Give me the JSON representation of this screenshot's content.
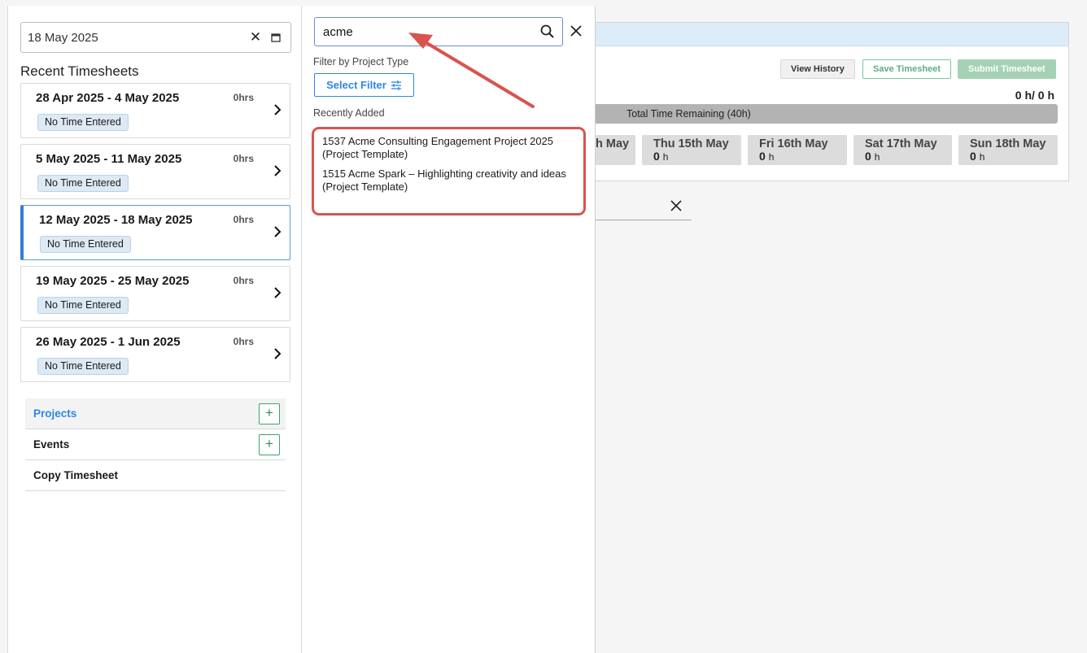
{
  "sidebar": {
    "date_value": "18 May 2025",
    "recent_title": "Recent Timesheets",
    "timesheets": [
      {
        "range": "28 Apr 2025 - 4 May 2025",
        "hours": "0hrs",
        "status": "No Time Entered"
      },
      {
        "range": "5 May 2025 - 11 May 2025",
        "hours": "0hrs",
        "status": "No Time Entered"
      },
      {
        "range": "12 May 2025 - 18 May 2025",
        "hours": "0hrs",
        "status": "No Time Entered"
      },
      {
        "range": "19 May 2025 - 25 May 2025",
        "hours": "0hrs",
        "status": "No Time Entered"
      },
      {
        "range": "26 May 2025 - 1 Jun 2025",
        "hours": "0hrs",
        "status": "No Time Entered"
      }
    ],
    "menu": {
      "projects": "Projects",
      "events": "Events",
      "copy_timesheet": "Copy Timesheet",
      "plus": "+"
    }
  },
  "panel": {
    "search_value": "acme",
    "filter_label": "Filter by Project Type",
    "filter_button": "Select Filter",
    "recently_added": "Recently Added",
    "results": [
      "1537 Acme Consulting Engagement Project 2025 (Project Template)",
      "1515 Acme Spark – Highlighting creativity and ideas (Project Template)"
    ]
  },
  "main": {
    "view_history": "View History",
    "save_timesheet": "Save Timesheet",
    "submit_timesheet": "Submit Timesheet",
    "total_hours": "0 h/ 0 h",
    "remaining": "Total Time Remaining (40h)",
    "days": [
      {
        "name": "h May",
        "hours": "",
        "unit": ""
      },
      {
        "name": "Thu 15th May",
        "hours": "0",
        "unit": "h"
      },
      {
        "name": "Fri 16th May",
        "hours": "0",
        "unit": "h"
      },
      {
        "name": "Sat 17th May",
        "hours": "0",
        "unit": "h"
      },
      {
        "name": "Sun 18th May",
        "hours": "0",
        "unit": "h"
      }
    ]
  },
  "colors": {
    "accent_blue": "#2e86e6",
    "annotation_red": "#d9534f",
    "success_green": "#3aa56b"
  }
}
